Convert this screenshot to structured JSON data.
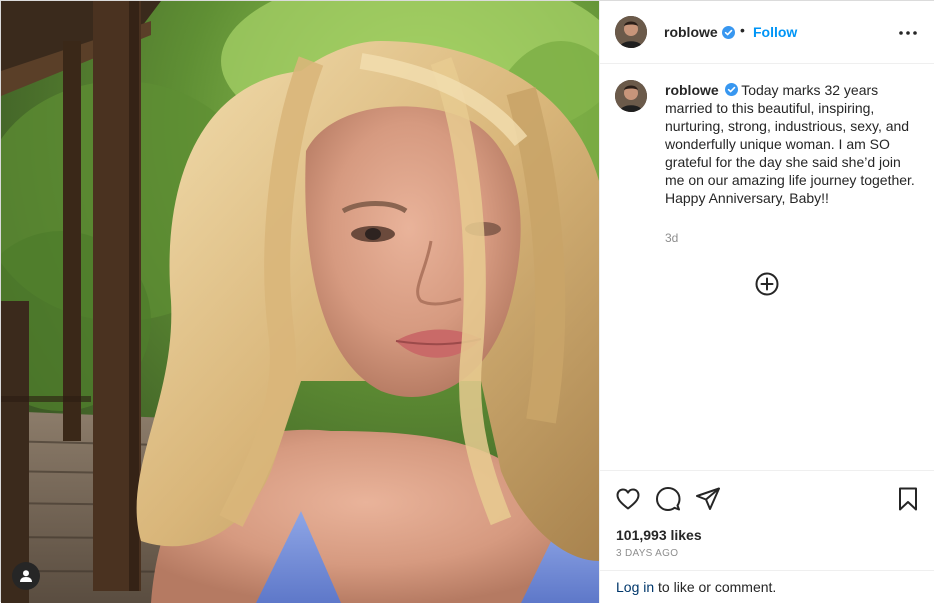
{
  "post": {
    "author": {
      "username": "roblowe",
      "verified": true,
      "follow_label": "Follow",
      "separator": "•"
    },
    "caption": {
      "text": "Today marks 32 years married to this beautiful, inspiring, nurturing, strong, industrious, sexy, and wonderfully unique woman. I am SO grateful for the day she said she’d join me on our amazing life journey together. Happy Anniversary, Baby!!",
      "time_ago": "3d"
    },
    "likes": "101,993 likes",
    "date": "3 DAYS AGO",
    "login_prompt": {
      "link": "Log in",
      "rest": " to like or comment."
    }
  },
  "icons": {
    "more": "more-options-icon",
    "verified": "verified-badge-icon",
    "add_comments": "plus-circle-icon",
    "like": "heart-icon",
    "comment": "comment-icon",
    "share": "paper-plane-icon",
    "save": "bookmark-icon",
    "tags": "user-tag-icon"
  },
  "colors": {
    "follow": "#0095f6",
    "verified": "#3897f0",
    "muted": "#8e8e8e",
    "link": "#00376b"
  }
}
